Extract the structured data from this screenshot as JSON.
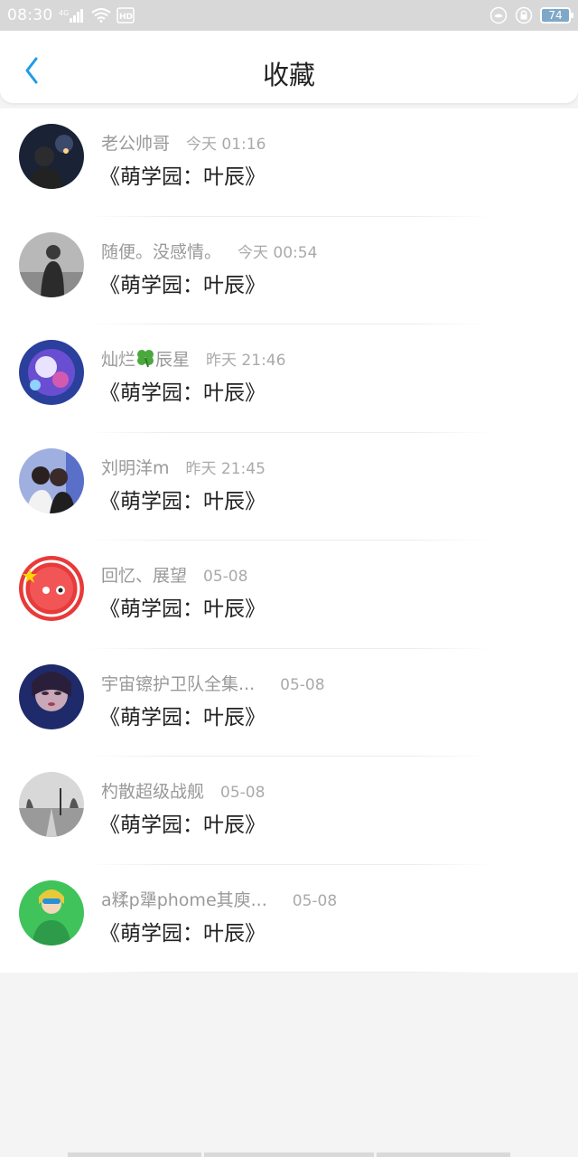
{
  "status_bar": {
    "time": "08:30",
    "network": "4G",
    "hd": "HD",
    "battery": "74"
  },
  "header": {
    "title": "收藏"
  },
  "favorites": [
    {
      "name": "老公帅哥",
      "time": "今天 01:16",
      "content": "《萌学园：叶辰》"
    },
    {
      "name": "随便。没感情。",
      "time": "今天 00:54",
      "content": "《萌学园：叶辰》"
    },
    {
      "name_before": "灿烂",
      "name_after": "辰星",
      "time": "昨天 21:46",
      "content": "《萌学园：叶辰》"
    },
    {
      "name": "刘明洋m",
      "time": "昨天 21:45",
      "content": "《萌学园：叶辰》"
    },
    {
      "name": "回忆、展望",
      "time": "05-08",
      "content": "《萌学园：叶辰》"
    },
    {
      "name": "宇宙镲护卫队全集...",
      "time": "05-08",
      "content": "《萌学园：叶辰》"
    },
    {
      "name": "杓散超级战舰",
      "time": "05-08",
      "content": "《萌学园：叶辰》"
    },
    {
      "name": "a糅p犟phome其庾...",
      "time": "05-08",
      "content": "《萌学园：叶辰》"
    }
  ],
  "colors": {
    "accent": "#1e9be8",
    "status_bar": "#d8d8d8",
    "page_background": "#f5f4f5"
  }
}
